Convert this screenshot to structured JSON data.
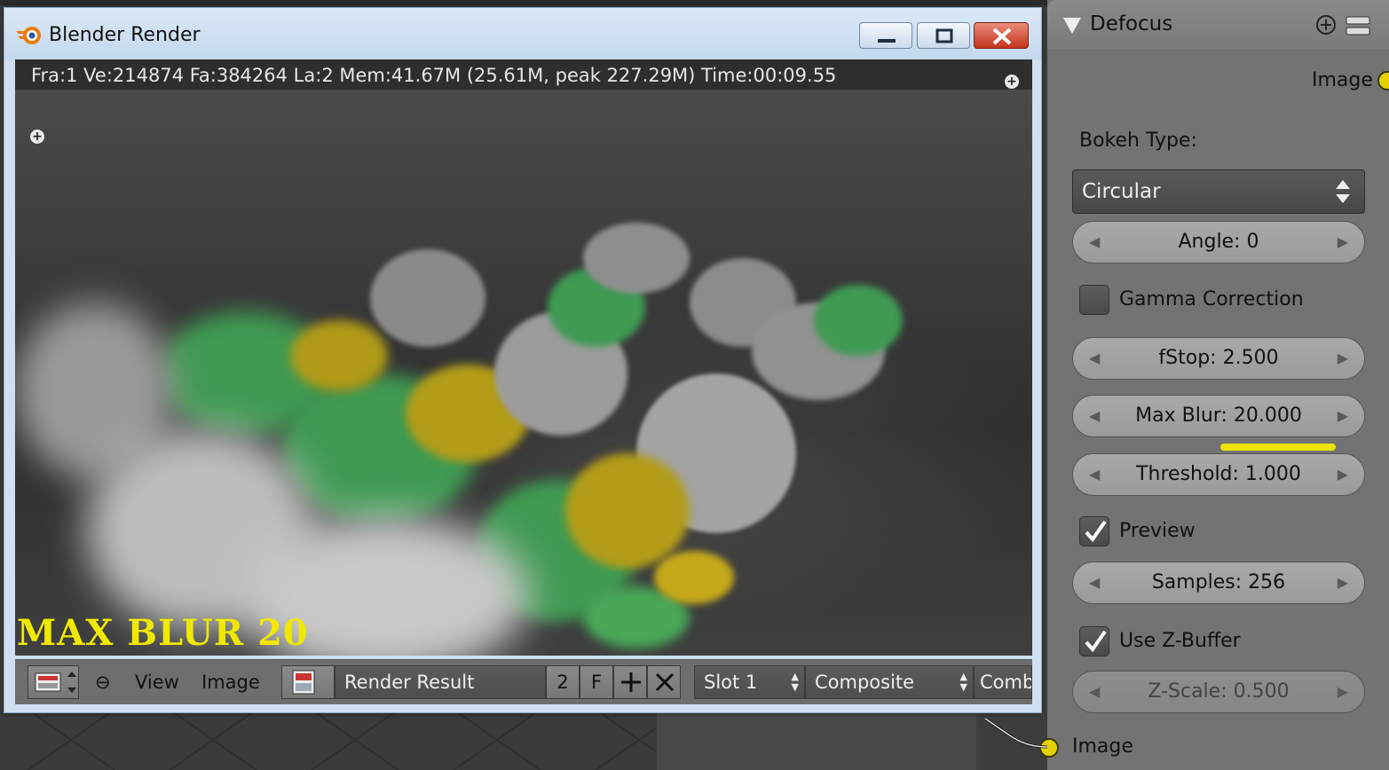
{
  "window": {
    "title": "Blender Render",
    "stats": "Fra:1  Ve:214874 Fa:384264 La:2 Mem:41.67M (25.61M, peak 227.29M) Time:00:09.55",
    "caption": "MAX BLUR 20"
  },
  "image_header": {
    "view_label": "View",
    "image_label": "Image",
    "image_name": "Render Result",
    "users": "2",
    "fake": "F",
    "slot": "Slot 1",
    "layer": "Composite",
    "pass": "Combi"
  },
  "node": {
    "title": "Defocus",
    "output_socket": "Image",
    "bokeh_type_label": "Bokeh Type:",
    "bokeh_type_value": "Circular",
    "angle": "Angle: 0",
    "gamma_correction": {
      "label": "Gamma Correction",
      "checked": false
    },
    "fstop": "fStop: 2.500",
    "max_blur": "Max Blur: 20.000",
    "threshold": "Threshold: 1.000",
    "preview": {
      "label": "Preview",
      "checked": true
    },
    "samples": "Samples: 256",
    "use_zbuffer": {
      "label": "Use Z-Buffer",
      "checked": true
    },
    "zscale": "Z-Scale: 0.500",
    "input_socket": "Image"
  },
  "colors": {
    "socket": "#e6d100",
    "caption": "#f0e800",
    "highlight": "#ece400"
  }
}
